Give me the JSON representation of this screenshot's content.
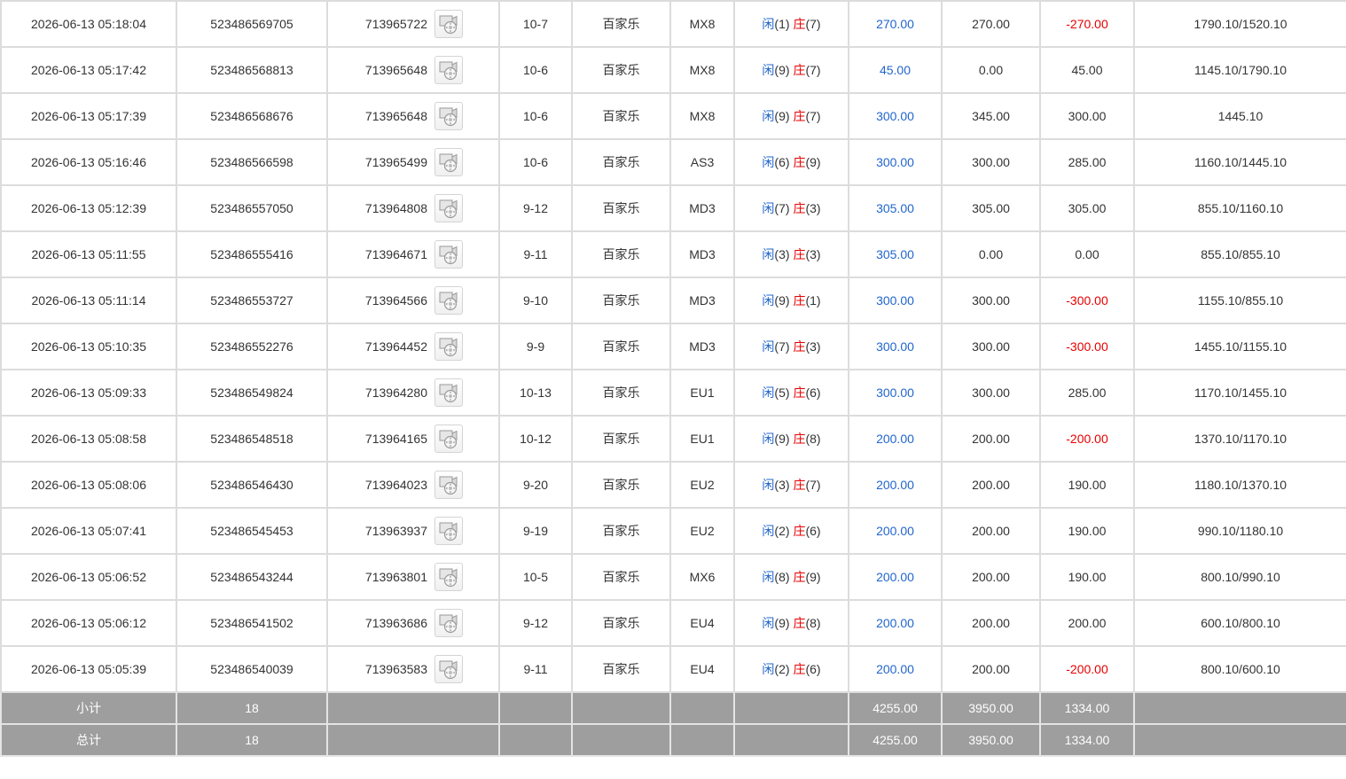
{
  "rows": [
    {
      "time": "2026-06-13 05:18:04",
      "bet_id": "523486569705",
      "round": "713965722",
      "table": "10-7",
      "game": "百家乐",
      "venue": "MX8",
      "player_label": "闲",
      "player_score": "(1)",
      "banker_label": "庄",
      "banker_score": "(7)",
      "bet": "270.00",
      "valid": "270.00",
      "result": "-270.00",
      "balance": "1790.10/1520.10"
    },
    {
      "time": "2026-06-13 05:17:42",
      "bet_id": "523486568813",
      "round": "713965648",
      "table": "10-6",
      "game": "百家乐",
      "venue": "MX8",
      "player_label": "闲",
      "player_score": "(9)",
      "banker_label": "庄",
      "banker_score": "(7)",
      "bet": "45.00",
      "valid": "0.00",
      "result": "45.00",
      "balance": "1145.10/1790.10"
    },
    {
      "time": "2026-06-13 05:17:39",
      "bet_id": "523486568676",
      "round": "713965648",
      "table": "10-6",
      "game": "百家乐",
      "venue": "MX8",
      "player_label": "闲",
      "player_score": "(9)",
      "banker_label": "庄",
      "banker_score": "(7)",
      "bet": "300.00",
      "valid": "345.00",
      "result": "300.00",
      "balance": "1445.10"
    },
    {
      "time": "2026-06-13 05:16:46",
      "bet_id": "523486566598",
      "round": "713965499",
      "table": "10-6",
      "game": "百家乐",
      "venue": "AS3",
      "player_label": "闲",
      "player_score": "(6)",
      "banker_label": "庄",
      "banker_score": "(9)",
      "bet": "300.00",
      "valid": "300.00",
      "result": "285.00",
      "balance": "1160.10/1445.10"
    },
    {
      "time": "2026-06-13 05:12:39",
      "bet_id": "523486557050",
      "round": "713964808",
      "table": "9-12",
      "game": "百家乐",
      "venue": "MD3",
      "player_label": "闲",
      "player_score": "(7)",
      "banker_label": "庄",
      "banker_score": "(3)",
      "bet": "305.00",
      "valid": "305.00",
      "result": "305.00",
      "balance": "855.10/1160.10"
    },
    {
      "time": "2026-06-13 05:11:55",
      "bet_id": "523486555416",
      "round": "713964671",
      "table": "9-11",
      "game": "百家乐",
      "venue": "MD3",
      "player_label": "闲",
      "player_score": "(3)",
      "banker_label": "庄",
      "banker_score": "(3)",
      "bet": "305.00",
      "valid": "0.00",
      "result": "0.00",
      "balance": "855.10/855.10"
    },
    {
      "time": "2026-06-13 05:11:14",
      "bet_id": "523486553727",
      "round": "713964566",
      "table": "9-10",
      "game": "百家乐",
      "venue": "MD3",
      "player_label": "闲",
      "player_score": "(9)",
      "banker_label": "庄",
      "banker_score": "(1)",
      "bet": "300.00",
      "valid": "300.00",
      "result": "-300.00",
      "balance": "1155.10/855.10"
    },
    {
      "time": "2026-06-13 05:10:35",
      "bet_id": "523486552276",
      "round": "713964452",
      "table": "9-9",
      "game": "百家乐",
      "venue": "MD3",
      "player_label": "闲",
      "player_score": "(7)",
      "banker_label": "庄",
      "banker_score": "(3)",
      "bet": "300.00",
      "valid": "300.00",
      "result": "-300.00",
      "balance": "1455.10/1155.10"
    },
    {
      "time": "2026-06-13 05:09:33",
      "bet_id": "523486549824",
      "round": "713964280",
      "table": "10-13",
      "game": "百家乐",
      "venue": "EU1",
      "player_label": "闲",
      "player_score": "(5)",
      "banker_label": "庄",
      "banker_score": "(6)",
      "bet": "300.00",
      "valid": "300.00",
      "result": "285.00",
      "balance": "1170.10/1455.10"
    },
    {
      "time": "2026-06-13 05:08:58",
      "bet_id": "523486548518",
      "round": "713964165",
      "table": "10-12",
      "game": "百家乐",
      "venue": "EU1",
      "player_label": "闲",
      "player_score": "(9)",
      "banker_label": "庄",
      "banker_score": "(8)",
      "bet": "200.00",
      "valid": "200.00",
      "result": "-200.00",
      "balance": "1370.10/1170.10"
    },
    {
      "time": "2026-06-13 05:08:06",
      "bet_id": "523486546430",
      "round": "713964023",
      "table": "9-20",
      "game": "百家乐",
      "venue": "EU2",
      "player_label": "闲",
      "player_score": "(3)",
      "banker_label": "庄",
      "banker_score": "(7)",
      "bet": "200.00",
      "valid": "200.00",
      "result": "190.00",
      "balance": "1180.10/1370.10"
    },
    {
      "time": "2026-06-13 05:07:41",
      "bet_id": "523486545453",
      "round": "713963937",
      "table": "9-19",
      "game": "百家乐",
      "venue": "EU2",
      "player_label": "闲",
      "player_score": "(2)",
      "banker_label": "庄",
      "banker_score": "(6)",
      "bet": "200.00",
      "valid": "200.00",
      "result": "190.00",
      "balance": "990.10/1180.10"
    },
    {
      "time": "2026-06-13 05:06:52",
      "bet_id": "523486543244",
      "round": "713963801",
      "table": "10-5",
      "game": "百家乐",
      "venue": "MX6",
      "player_label": "闲",
      "player_score": "(8)",
      "banker_label": "庄",
      "banker_score": "(9)",
      "bet": "200.00",
      "valid": "200.00",
      "result": "190.00",
      "balance": "800.10/990.10"
    },
    {
      "time": "2026-06-13 05:06:12",
      "bet_id": "523486541502",
      "round": "713963686",
      "table": "9-12",
      "game": "百家乐",
      "venue": "EU4",
      "player_label": "闲",
      "player_score": "(9)",
      "banker_label": "庄",
      "banker_score": "(8)",
      "bet": "200.00",
      "valid": "200.00",
      "result": "200.00",
      "balance": "600.10/800.10"
    },
    {
      "time": "2026-06-13 05:05:39",
      "bet_id": "523486540039",
      "round": "713963583",
      "table": "9-11",
      "game": "百家乐",
      "venue": "EU4",
      "player_label": "闲",
      "player_score": "(2)",
      "banker_label": "庄",
      "banker_score": "(6)",
      "bet": "200.00",
      "valid": "200.00",
      "result": "-200.00",
      "balance": "800.10/600.10"
    }
  ],
  "subtotal": {
    "label": "小计",
    "count": "18",
    "bet": "4255.00",
    "valid": "3950.00",
    "result": "1334.00"
  },
  "total": {
    "label": "总计",
    "count": "18",
    "bet": "4255.00",
    "valid": "3950.00",
    "result": "1334.00"
  },
  "icons": {
    "replay": "video-replay-icon"
  },
  "colors": {
    "player": "#2266cc",
    "banker": "#e60000",
    "negative": "#e60000",
    "summary_bg": "#9e9e9e"
  }
}
